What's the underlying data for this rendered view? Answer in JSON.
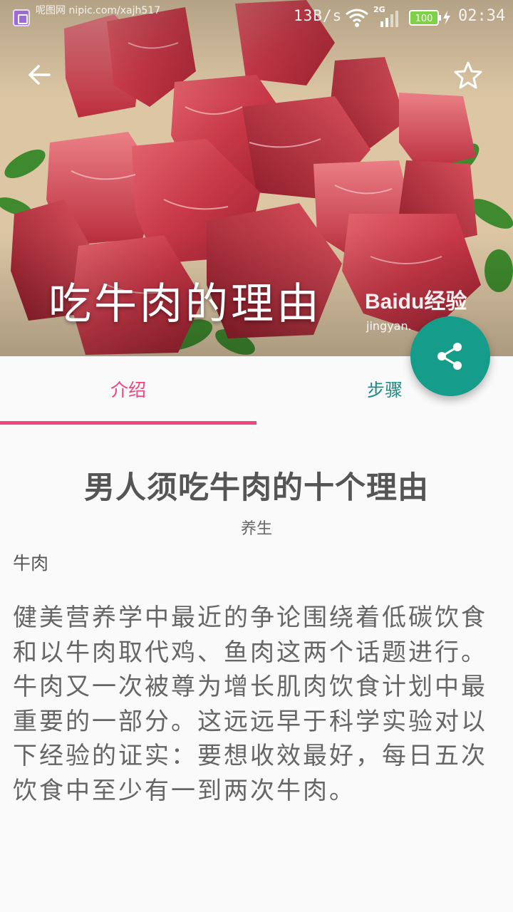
{
  "status_bar": {
    "watermark": "呢图网 nipic.com/xajh517",
    "net_speed": "13B/s",
    "network_type": "2G",
    "battery": "100",
    "time": "02:34"
  },
  "header": {
    "back_icon": "arrow-back-icon",
    "favorite_icon": "star-outline-icon",
    "title": "吃牛肉的理由",
    "baidu_watermark": {
      "logo": "Baidu经验",
      "sub": "jingyan."
    }
  },
  "fab": {
    "icon": "share-icon",
    "color": "#169c8b"
  },
  "tabs": [
    {
      "label": "介绍",
      "active": true,
      "color": "#f0457d"
    },
    {
      "label": "步骤",
      "active": false,
      "color": "#1e8b84"
    }
  ],
  "article": {
    "title": "男人须吃牛肉的十个理由",
    "category": "养生",
    "tag": "牛肉",
    "body": "健美营养学中最近的争论围绕着低碳饮食和以牛肉取代鸡、鱼肉这两个话题进行。牛肉又一次被尊为增长肌肉饮食计划中最重要的一部分。这远远早于科学实验对以下经验的证实：要想收效最好，每日五次饮食中至少有一到两次牛肉。"
  }
}
